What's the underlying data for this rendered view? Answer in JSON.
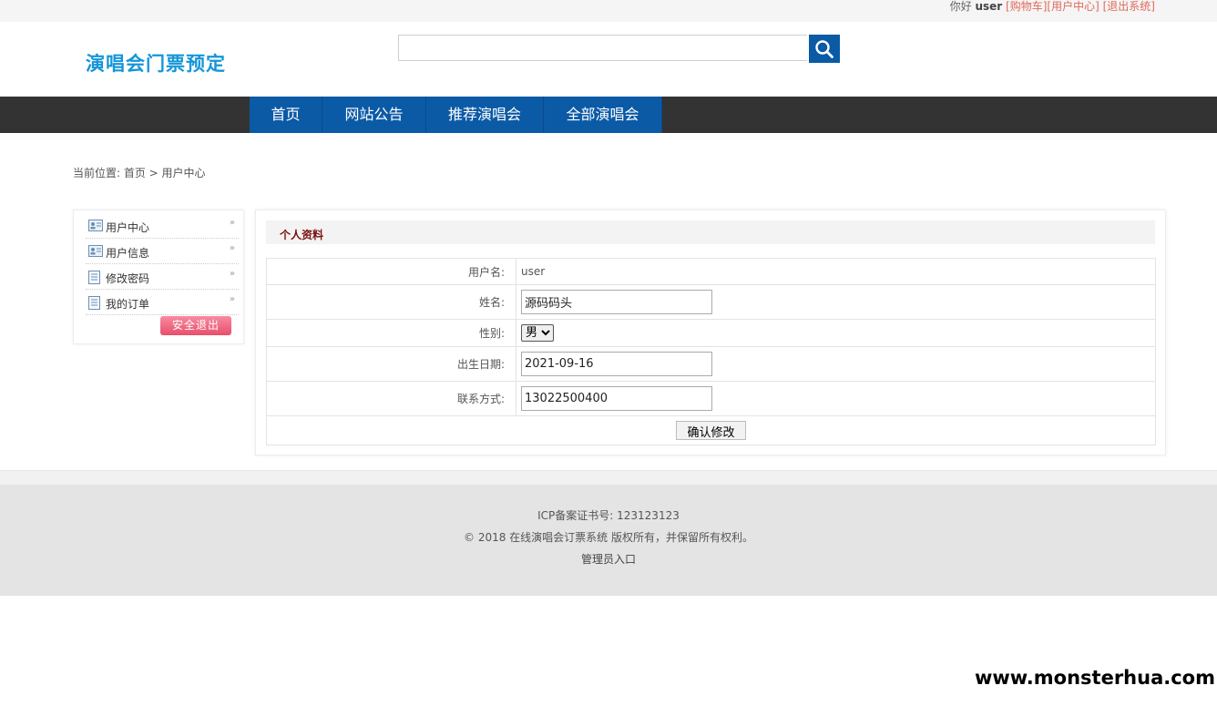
{
  "topbar": {
    "greeting": "你好",
    "username": "user",
    "links": [
      "[购物车]",
      "[用户中心]",
      "[退出系统]"
    ]
  },
  "header": {
    "logo": "演唱会门票预定",
    "search_placeholder": ""
  },
  "nav": {
    "items": [
      "首页",
      "网站公告",
      "推荐演唱会",
      "全部演唱会"
    ]
  },
  "breadcrumb": "当前位置: 首页 > 用户中心",
  "sidebar": {
    "items": [
      "用户中心",
      "用户信息",
      "修改密码",
      "我的订单"
    ],
    "logout": "安全退出"
  },
  "panel": {
    "title": "个人资料",
    "rows": {
      "username_label": "用户名:",
      "username_value": "user",
      "name_label": "姓名:",
      "name_value": "源码码头",
      "gender_label": "性别:",
      "gender_value": "男",
      "birth_label": "出生日期:",
      "birth_value": "2021-09-16",
      "phone_label": "联系方式:",
      "phone_value": "13022500400"
    },
    "submit": "确认修改"
  },
  "footer": {
    "icp": "ICP备案证书号: 123123123",
    "copyright": "© 2018 在线演唱会订票系统 版权所有，并保留所有权利。",
    "admin": "管理员入口"
  },
  "watermark": "www.monsterhua.com",
  "colors": {
    "brand_blue": "#0b5aa6",
    "logo_blue": "#1596d8",
    "nav_dark": "#333333",
    "title_red": "#7a1010"
  }
}
